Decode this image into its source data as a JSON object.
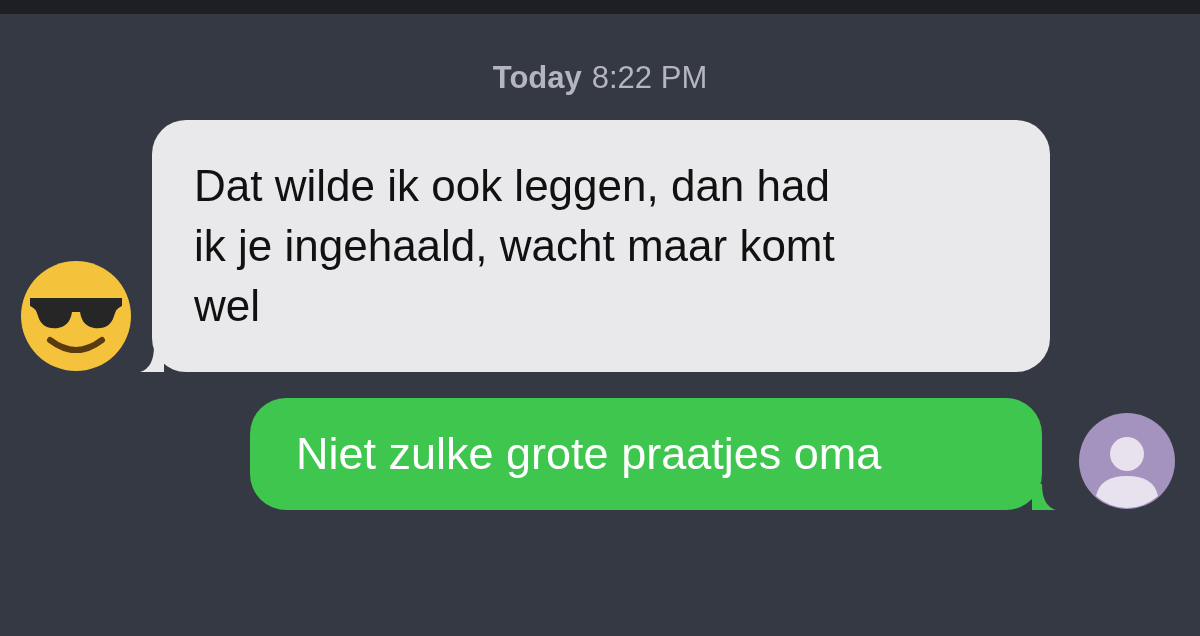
{
  "timestamp": {
    "day": "Today",
    "time": "8:22 PM"
  },
  "messages": [
    {
      "kind": "incoming",
      "lines": [
        "Dat wilde ik ook leggen, dan had",
        "ik je ingehaald, wacht maar komt",
        "wel"
      ]
    },
    {
      "kind": "outgoing",
      "lines": [
        "Niet zulke grote praatjes oma"
      ]
    }
  ]
}
